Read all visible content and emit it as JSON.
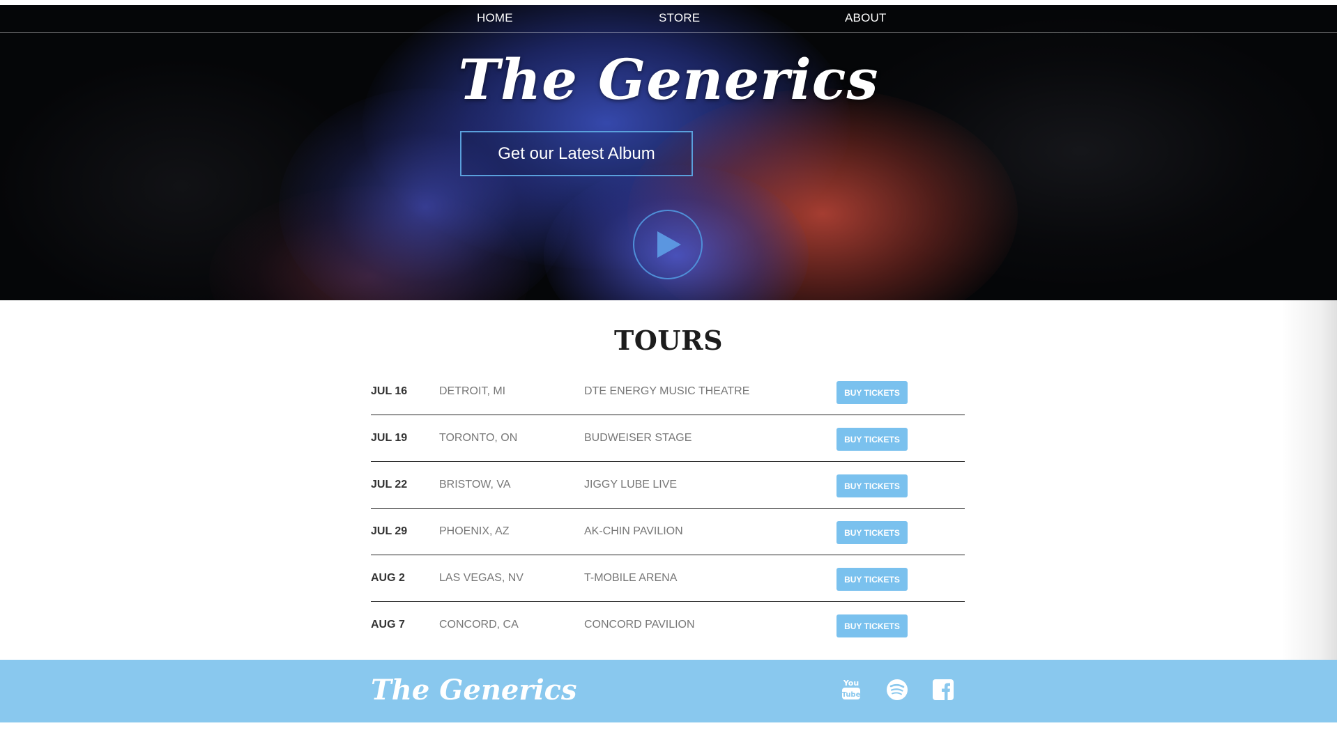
{
  "nav": {
    "home": "HOME",
    "store": "STORE",
    "about": "ABOUT"
  },
  "hero": {
    "title": "The Generics",
    "album_button": "Get our Latest Album",
    "play_icon": "play-icon"
  },
  "tours": {
    "title": "TOURS",
    "rows": [
      {
        "date": "JUL 16",
        "city": "DETROIT, MI",
        "venue": "DTE ENERGY MUSIC THEATRE",
        "button": "BUY TICKETS"
      },
      {
        "date": "JUL 19",
        "city": "TORONTO, ON",
        "venue": "BUDWEISER STAGE",
        "button": "BUY TICKETS"
      },
      {
        "date": "JUL 22",
        "city": "BRISTOW, VA",
        "venue": "JIGGY LUBE LIVE",
        "button": "BUY TICKETS"
      },
      {
        "date": "JUL 29",
        "city": "PHOENIX, AZ",
        "venue": "AK-CHIN PAVILION",
        "button": "BUY TICKETS"
      },
      {
        "date": "AUG 2",
        "city": "LAS VEGAS, NV",
        "venue": "T-MOBILE ARENA",
        "button": "BUY TICKETS"
      },
      {
        "date": "AUG 7",
        "city": "CONCORD, CA",
        "venue": "CONCORD PAVILION",
        "button": "BUY TICKETS"
      }
    ]
  },
  "footer": {
    "logo": "The Generics",
    "icons": [
      "youtube-icon",
      "spotify-icon",
      "facebook-icon"
    ]
  },
  "colors": {
    "accent": "#7ac1ee",
    "footer_bg": "#89c8ee",
    "hero_button_border": "#5aa0dc",
    "play_accent": "#4f8fd8"
  }
}
